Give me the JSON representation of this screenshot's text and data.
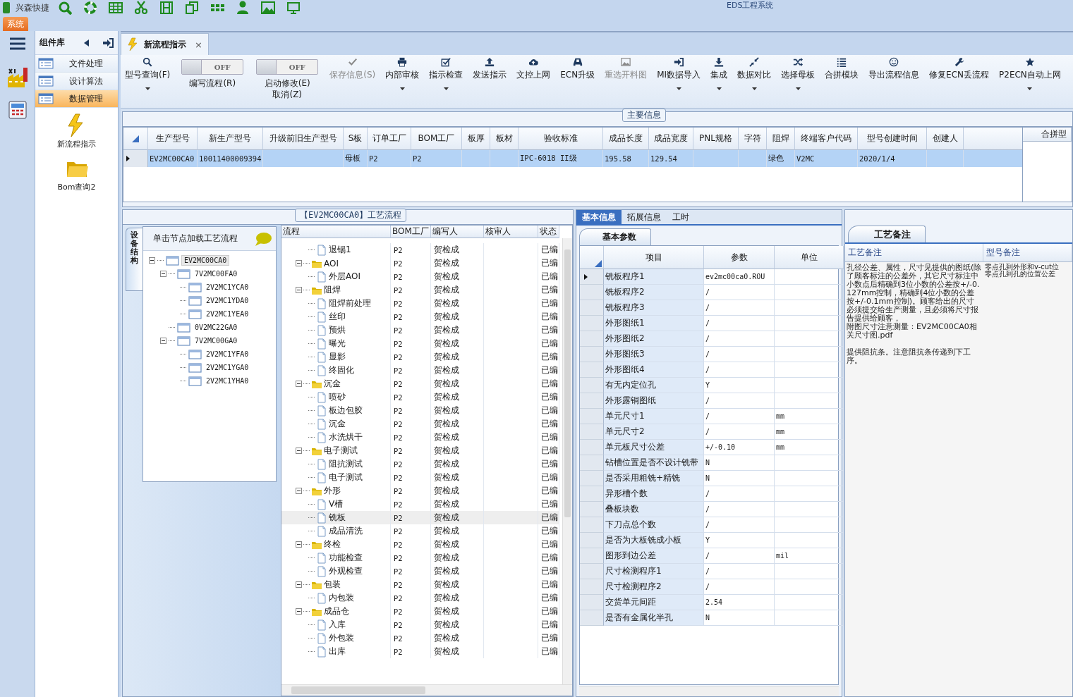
{
  "app": {
    "quick_access_title": "兴森快捷",
    "title": "EDS工程系统",
    "menu_tab": "系统"
  },
  "sidebar": {
    "title": "组件库",
    "items": [
      {
        "label": "文件处理",
        "selected": false
      },
      {
        "label": "设计算法",
        "selected": false
      },
      {
        "label": "数据管理",
        "selected": true
      }
    ],
    "modules": [
      "新流程指示",
      "Bom查询2"
    ]
  },
  "document_tab": {
    "title": "新流程指示",
    "close": "×"
  },
  "ribbon": [
    {
      "kind": "button",
      "label": "型号查询(F)",
      "disabled": false,
      "dropdown": true
    },
    {
      "kind": "toggle",
      "label": "编写流程(R)",
      "state_text": "OFF",
      "on": false
    },
    {
      "kind": "toggle",
      "label": "启动修改(E)\n取消(Z)",
      "state_text": "OFF",
      "on": false
    },
    {
      "kind": "button",
      "label": "保存信息(S)",
      "disabled": true,
      "dropdown": false
    },
    {
      "kind": "button",
      "label": "内部审核",
      "disabled": false,
      "dropdown": true
    },
    {
      "kind": "button",
      "label": "指示检查",
      "disabled": false,
      "dropdown": true
    },
    {
      "kind": "button",
      "label": "发送指示",
      "disabled": false,
      "dropdown": false
    },
    {
      "kind": "button",
      "label": "文控上网",
      "disabled": false,
      "dropdown": false
    },
    {
      "kind": "button",
      "label": "ECN升级",
      "disabled": false,
      "dropdown": false
    },
    {
      "kind": "button",
      "label": "重选开料图",
      "disabled": true,
      "dropdown": false
    },
    {
      "kind": "button",
      "label": "MI数据导入",
      "disabled": false,
      "dropdown": true
    },
    {
      "kind": "button",
      "label": "集成",
      "disabled": false,
      "dropdown": true
    },
    {
      "kind": "button",
      "label": "数据对比",
      "disabled": false,
      "dropdown": true
    },
    {
      "kind": "button",
      "label": "选择母板",
      "disabled": false,
      "dropdown": true
    },
    {
      "kind": "button",
      "label": "合拼模块",
      "disabled": false,
      "dropdown": false
    },
    {
      "kind": "button",
      "label": "导出流程信息",
      "disabled": false,
      "dropdown": false
    },
    {
      "kind": "button",
      "label": "修复ECN丢流程",
      "disabled": false,
      "dropdown": false
    },
    {
      "kind": "button",
      "label": "P2ECN自动上网",
      "disabled": false,
      "dropdown": true
    }
  ],
  "main_info": {
    "title": "主要信息",
    "columns": [
      "生产型号",
      "新生产型号",
      "升级前旧生产型号",
      "S板",
      "订单工厂",
      "BOM工厂",
      "板厚",
      "板材",
      "验收标准",
      "成品长度",
      "成品宽度",
      "PNL规格",
      "字符",
      "阻焊",
      "终端客户代码",
      "型号创建时间",
      "创建人"
    ],
    "rows": [
      {
        "selected": true,
        "cells": [
          "EV2MC00CA0",
          "10011400009394",
          "",
          "母板",
          "P2",
          "P2",
          "",
          "",
          "IPC-6018 II级",
          "195.58",
          "129.54",
          "",
          "",
          "绿色",
          "V2MC",
          "2020/1/4",
          ""
        ]
      }
    ],
    "side_column": "合拼型"
  },
  "flow": {
    "title": "【EV2MC00CA0】工艺流程",
    "side_tab": "设备结构",
    "tree_header": "单击节点加载工艺流程",
    "device_tree": [
      {
        "label": "EV2MC00CA0",
        "selected": true,
        "expanded": true,
        "children": [
          {
            "label": "7V2MC00FA0",
            "selected": false,
            "expanded": true,
            "children": [
              {
                "label": "2V2MC1YCA0",
                "selected": false
              },
              {
                "label": "2V2MC1YDA0",
                "selected": false
              },
              {
                "label": "2V2MC1YEA0",
                "selected": false
              }
            ]
          },
          {
            "label": "0V2MC22GA0",
            "selected": false
          },
          {
            "label": "7V2MC00GA0",
            "selected": false,
            "expanded": true,
            "children": [
              {
                "label": "2V2MC1YFA0",
                "selected": false
              },
              {
                "label": "2V2MC1YGA0",
                "selected": false
              },
              {
                "label": "2V2MC1YHA0",
                "selected": false
              }
            ]
          }
        ]
      }
    ],
    "columns": [
      "流程",
      "BOM工厂",
      "编写人",
      "核审人",
      "状态"
    ],
    "steps": [
      {
        "children": [
          {
            "name": "退锡1",
            "bom": "P2",
            "writer": "贺检成",
            "status": "已编",
            "selected": false
          }
        ]
      },
      {
        "name": "AOI",
        "bom": "P2",
        "writer": "贺检成",
        "status": "已编",
        "selected": false,
        "expanded": true,
        "children": [
          {
            "name": "外层AOI",
            "bom": "P2",
            "writer": "贺检成",
            "status": "已编",
            "selected": false
          }
        ]
      },
      {
        "name": "阻焊",
        "bom": "P2",
        "writer": "贺检成",
        "status": "已编",
        "selected": false,
        "expanded": true,
        "children": [
          {
            "name": "阻焊前处理",
            "bom": "P2",
            "writer": "贺检成",
            "status": "已编",
            "selected": false
          },
          {
            "name": "丝印",
            "bom": "P2",
            "writer": "贺检成",
            "status": "已编",
            "selected": false
          },
          {
            "name": "预烘",
            "bom": "P2",
            "writer": "贺检成",
            "status": "已编",
            "selected": false
          },
          {
            "name": "曝光",
            "bom": "P2",
            "writer": "贺检成",
            "status": "已编",
            "selected": false
          },
          {
            "name": "显影",
            "bom": "P2",
            "writer": "贺检成",
            "status": "已编",
            "selected": false
          },
          {
            "name": "终固化",
            "bom": "P2",
            "writer": "贺检成",
            "status": "已编",
            "selected": false
          }
        ]
      },
      {
        "name": "沉金",
        "bom": "P2",
        "writer": "贺检成",
        "status": "已编",
        "selected": false,
        "expanded": true,
        "children": [
          {
            "name": "喷砂",
            "bom": "P2",
            "writer": "贺检成",
            "status": "已编",
            "selected": false
          },
          {
            "name": "板边包胶",
            "bom": "P2",
            "writer": "贺检成",
            "status": "已编",
            "selected": false
          },
          {
            "name": "沉金",
            "bom": "P2",
            "writer": "贺检成",
            "status": "已编",
            "selected": false
          },
          {
            "name": "水洗烘干",
            "bom": "P2",
            "writer": "贺检成",
            "status": "已编",
            "selected": false
          }
        ]
      },
      {
        "name": "电子测试",
        "bom": "P2",
        "writer": "贺检成",
        "status": "已编",
        "selected": false,
        "expanded": true,
        "children": [
          {
            "name": "阻抗测试",
            "bom": "P2",
            "writer": "贺检成",
            "status": "已编",
            "selected": false
          },
          {
            "name": "电子测试",
            "bom": "P2",
            "writer": "贺检成",
            "status": "已编",
            "selected": false
          }
        ]
      },
      {
        "name": "外形",
        "bom": "P2",
        "writer": "贺检成",
        "status": "已编",
        "selected": false,
        "expanded": true,
        "children": [
          {
            "name": "V槽",
            "bom": "P2",
            "writer": "贺检成",
            "status": "已编",
            "selected": false
          },
          {
            "name": "铣板",
            "bom": "P2",
            "writer": "贺检成",
            "status": "已编",
            "selected": true
          },
          {
            "name": "成品清洗",
            "bom": "P2",
            "writer": "贺检成",
            "status": "已编",
            "selected": false
          }
        ]
      },
      {
        "name": "终检",
        "bom": "P2",
        "writer": "贺检成",
        "status": "已编",
        "selected": false,
        "expanded": true,
        "children": [
          {
            "name": "功能检查",
            "bom": "P2",
            "writer": "贺检成",
            "status": "已编",
            "selected": false
          },
          {
            "name": "外观检查",
            "bom": "P2",
            "writer": "贺检成",
            "status": "已编",
            "selected": false
          }
        ]
      },
      {
        "name": "包装",
        "bom": "P2",
        "writer": "贺检成",
        "status": "已编",
        "selected": false,
        "expanded": true,
        "children": [
          {
            "name": "内包装",
            "bom": "P2",
            "writer": "贺检成",
            "status": "已编",
            "selected": false
          }
        ]
      },
      {
        "name": "成品仓",
        "bom": "P2",
        "writer": "贺检成",
        "status": "已编",
        "selected": false,
        "expanded": true,
        "children": [
          {
            "name": "入库",
            "bom": "P2",
            "writer": "贺检成",
            "status": "已编",
            "selected": false
          },
          {
            "name": "外包装",
            "bom": "P2",
            "writer": "贺检成",
            "status": "已编",
            "selected": false
          },
          {
            "name": "出库",
            "bom": "P2",
            "writer": "贺检成",
            "status": "已编",
            "selected": false
          }
        ]
      }
    ]
  },
  "details": {
    "tabs": [
      {
        "label": "基本信息",
        "selected": true
      },
      {
        "label": "拓展信息",
        "selected": false
      },
      {
        "label": "工时",
        "selected": false
      }
    ],
    "sub_tab": "基本参数",
    "columns": [
      "项目",
      "参数",
      "单位"
    ],
    "rows": [
      {
        "item": "铣板程序1",
        "value": "ev2mc00ca0.ROU",
        "unit": "",
        "selected": true
      },
      {
        "item": "铣板程序2",
        "value": "/",
        "unit": "",
        "selected": false
      },
      {
        "item": "铣板程序3",
        "value": "/",
        "unit": "",
        "selected": false
      },
      {
        "item": "外形图纸1",
        "value": "/",
        "unit": "",
        "selected": false
      },
      {
        "item": "外形图纸2",
        "value": "/",
        "unit": "",
        "selected": false
      },
      {
        "item": "外形图纸3",
        "value": "/",
        "unit": "",
        "selected": false
      },
      {
        "item": "外形图纸4",
        "value": "/",
        "unit": "",
        "selected": false
      },
      {
        "item": "有无内定位孔",
        "value": "Y",
        "unit": "",
        "selected": false
      },
      {
        "item": "外形露铜图纸",
        "value": "/",
        "unit": "",
        "selected": false
      },
      {
        "item": "单元尺寸1",
        "value": "/",
        "unit": "mm",
        "selected": false
      },
      {
        "item": "单元尺寸2",
        "value": "/",
        "unit": "mm",
        "selected": false
      },
      {
        "item": "单元板尺寸公差",
        "value": "+/-0.10",
        "unit": "mm",
        "selected": false
      },
      {
        "item": "钻槽位置是否不设计铣带",
        "value": "N",
        "unit": "",
        "selected": false
      },
      {
        "item": "是否采用粗铣+精铣",
        "value": "N",
        "unit": "",
        "selected": false
      },
      {
        "item": "异形槽个数",
        "value": "/",
        "unit": "",
        "selected": false
      },
      {
        "item": "叠板块数",
        "value": "/",
        "unit": "",
        "selected": false
      },
      {
        "item": "下刀点总个数",
        "value": "/",
        "unit": "",
        "selected": false
      },
      {
        "item": "是否为大板铣成小板",
        "value": "Y",
        "unit": "",
        "selected": false
      },
      {
        "item": "图形到边公差",
        "value": "/",
        "unit": "mil",
        "selected": false
      },
      {
        "item": "尺寸检测程序1",
        "value": "/",
        "unit": "",
        "selected": false
      },
      {
        "item": "尺寸检测程序2",
        "value": "/",
        "unit": "",
        "selected": false
      },
      {
        "item": "交货单元间距",
        "value": "2.54",
        "unit": "",
        "selected": false
      },
      {
        "item": "是否有金属化半孔",
        "value": "N",
        "unit": "",
        "selected": false
      }
    ]
  },
  "notes": {
    "tab": "工艺备注",
    "columns": [
      "工艺备注",
      "型号备注"
    ],
    "process_note": [
      "孔径公差、属性，尺寸见提供的图纸(除了顾客标注的公差外，其它尺寸标注中小数点后精确到3位小数的公差按+/-0.127mm控制，精确到4位小数的公差按+/-0.1mm控制)。顾客给出的尺寸必须提交给生产测量，且必须将尺寸报告提供给顾客，",
      "附图尺寸注意测量：EV2MC00CA0相关尺寸图.pdf",
      "提供阻抗条。注意阻抗条传递到下工序。"
    ],
    "model_note": [
      "零点孔到外形和v-cut位",
      "零点孔到孔的位置公差"
    ]
  }
}
